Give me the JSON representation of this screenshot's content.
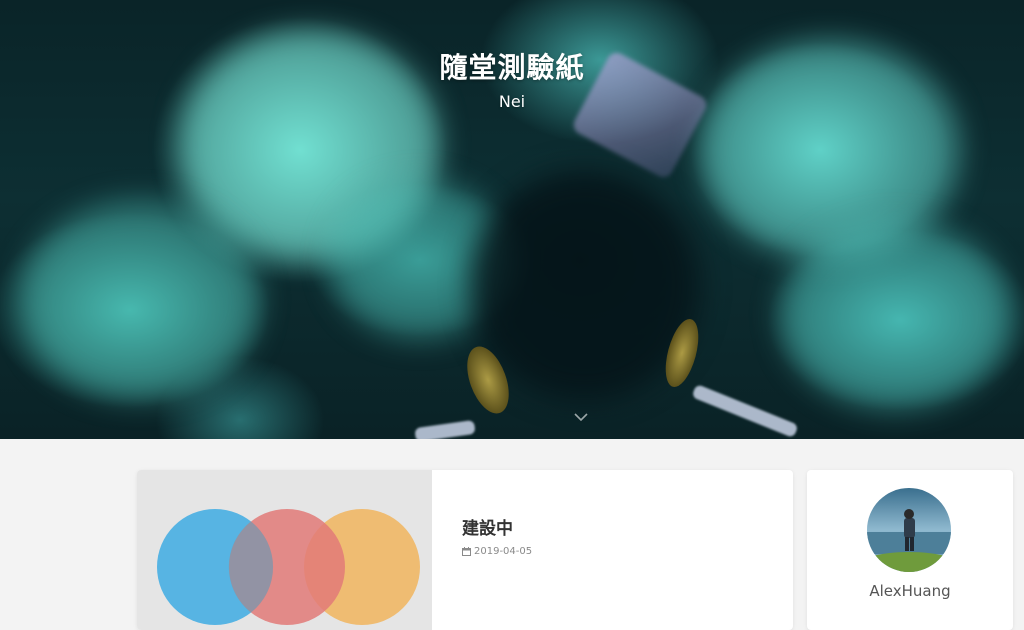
{
  "site": {
    "title": "隨堂測驗紙",
    "subtitle": "Nei"
  },
  "hero": {
    "scroll_icon": "chevron-down-icon"
  },
  "post": {
    "title": "建設中",
    "date": "2019-04-05",
    "date_icon": "calendar-icon",
    "cover_colors": [
      "#4fb1e3",
      "#e27a78",
      "#efb96b"
    ]
  },
  "profile": {
    "name": "AlexHuang"
  },
  "colors": {
    "page_background": "#f3f3f3",
    "card_background": "#ffffff",
    "cover_background": "#e5e5e5"
  }
}
